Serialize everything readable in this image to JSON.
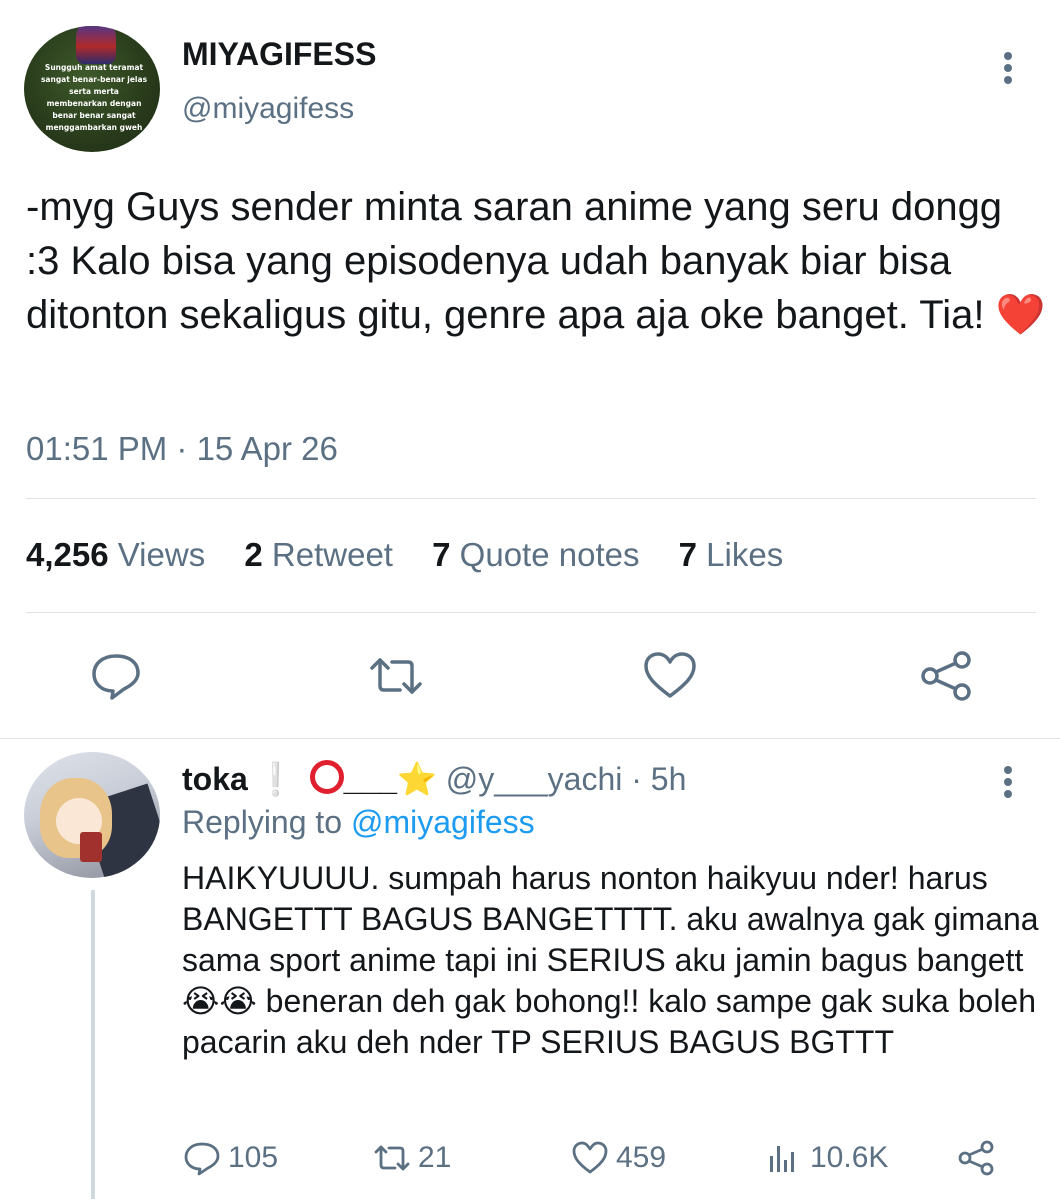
{
  "author": {
    "display_name": "MIYAGIFESS",
    "handle": "@miyagifess",
    "avatar_caption": "Sungguh amat teramat sangat benar-benar jelas serta merta membenarkan dengan benar benar sangat menggambarkan gweh"
  },
  "tweet": {
    "text": "-myg Guys sender minta saran anime yang seru dongg :3 Kalo bisa yang episodenya udah banyak biar bisa ditonton sekaligus gitu, genre apa aja oke banget. Tia! ",
    "emoji": "❤️",
    "timestamp": "01:51 PM · 15 Apr 26"
  },
  "stats": {
    "views_count": "4,256",
    "views_label": "Views",
    "retweets_count": "2",
    "retweets_label": "Retweet",
    "quotes_count": "7",
    "quotes_label": "Quote notes",
    "likes_count": "7",
    "likes_label": "Likes"
  },
  "actions": [
    "reply-icon",
    "retweet-icon",
    "like-icon",
    "share-icon"
  ],
  "reply": {
    "name": "toka",
    "name_decoration": "❕",
    "name_suffix": "___",
    "star": "⭐",
    "handle": "@y___yachi",
    "time": "· 5h",
    "replying_prefix": "Replying to",
    "replying_to": "@miyagifess",
    "text": "HAIKYUUUU. sumpah harus nonton haikyuu nder! harus BANGETTT BAGUS BANGETTTT. aku awalnya gak gimana sama sport anime tapi ini SERIUS aku jamin bagus bangett 😭😭 beneran deh gak bohong!! kalo sampe gak suka boleh pacarin aku deh nder TP SERIUS BAGUS BGTTT",
    "replies": "105",
    "retweets": "21",
    "likes": "459",
    "views": "10.6K"
  },
  "colors": {
    "text": "#14171a",
    "secondary": "#5b7083",
    "accent": "#1d9bf0",
    "heart": "#e0202e"
  }
}
